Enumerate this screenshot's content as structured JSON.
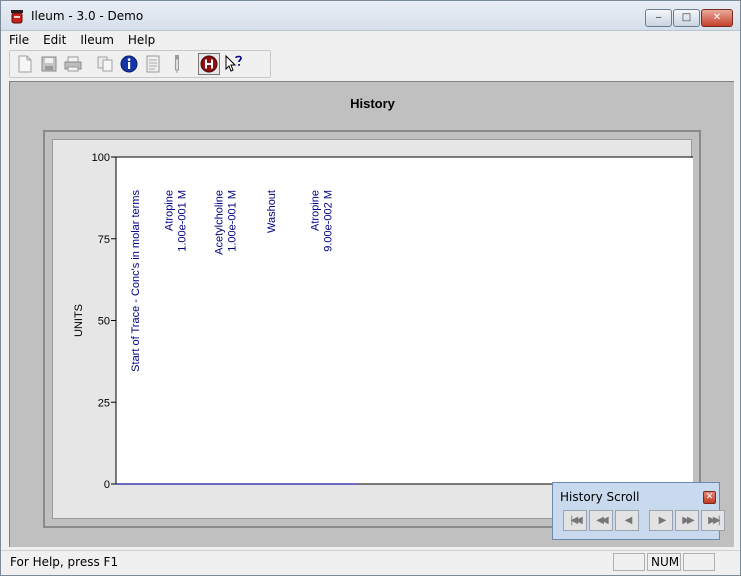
{
  "window": {
    "title": "Ileum - 3.0 - Demo",
    "minimize_label": "‒",
    "maximize_label": "□",
    "close_label": "✕"
  },
  "menu": {
    "items": [
      "File",
      "Edit",
      "Ileum",
      "Help"
    ]
  },
  "toolbar": {
    "buttons": [
      "new-file-icon",
      "save-icon",
      "print-icon",
      "copy-icon",
      "info-icon",
      "notes-icon",
      "pipette-icon",
      "history-icon",
      "help-pointer-icon"
    ]
  },
  "history": {
    "title": "History"
  },
  "chart_data": {
    "type": "line",
    "title": "",
    "ylabel": "UNITS",
    "xlabel": "",
    "ylim": [
      0,
      100
    ],
    "yticks": [
      "100",
      "75",
      "50",
      "25",
      "0"
    ],
    "grid": false,
    "annotations": [
      {
        "lines": [
          "Start of Trace - Conc's in molar terms"
        ]
      },
      {
        "lines": [
          "Atropine",
          "1.00e-001 M"
        ]
      },
      {
        "lines": [
          "Acetylcholine",
          "1.00e-001 M"
        ]
      },
      {
        "lines": [
          "Washout"
        ]
      },
      {
        "lines": [
          "Atropine",
          "9.00e-002 M"
        ]
      }
    ],
    "series": [
      {
        "values": [
          0,
          0
        ],
        "color": "#1a1aa0"
      }
    ],
    "trace_extent": [
      0,
      0.415
    ]
  },
  "history_scroll": {
    "title": "History Scroll",
    "close_label": "✕",
    "buttons": [
      "first-icon",
      "rewind-icon",
      "step-back-icon",
      "step-forward-icon",
      "fast-forward-icon",
      "last-icon"
    ],
    "button_glyphs": [
      "|◀◀",
      "◀◀",
      "◀",
      "▶",
      "▶▶",
      "▶▶|"
    ]
  },
  "status": {
    "help_text": "For Help, press F1",
    "panel1": "",
    "panel2": "NUM",
    "panel3": ""
  }
}
